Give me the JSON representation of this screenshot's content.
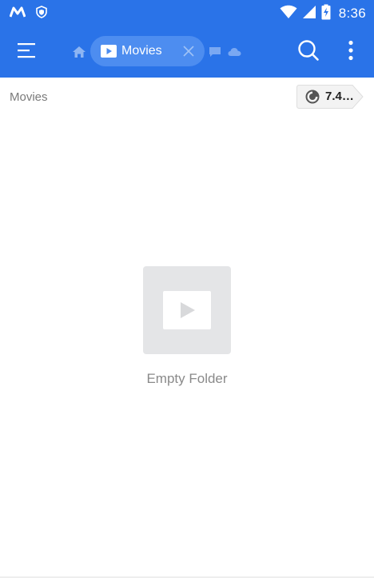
{
  "status_bar": {
    "time": "8:36",
    "left_icons": [
      "app-m-icon",
      "shield-icon"
    ],
    "right_icons": [
      "wifi-icon",
      "cell-signal-icon",
      "battery-charging-icon"
    ]
  },
  "toolbar": {
    "menu_icon": "hamburger-menu-icon",
    "home_icon": "home-icon",
    "current_tab_label": "Movies",
    "current_tab_icon": "video-play-icon",
    "close_icon": "close-icon",
    "extra_tab_icons": [
      "message-icon",
      "cloud-icon"
    ],
    "search_icon": "search-icon",
    "more_icon": "more-vertical-icon"
  },
  "path_row": {
    "title": "Movies",
    "storage_label": "7.4…",
    "storage_icon": "pie-chart-icon"
  },
  "empty_state": {
    "icon": "video-placeholder-icon",
    "label": "Empty Folder"
  },
  "colors": {
    "primary": "#2a73e8",
    "chip": "#4d8df0",
    "empty_box": "#e4e5e7",
    "muted_text": "#8a8a8a"
  }
}
